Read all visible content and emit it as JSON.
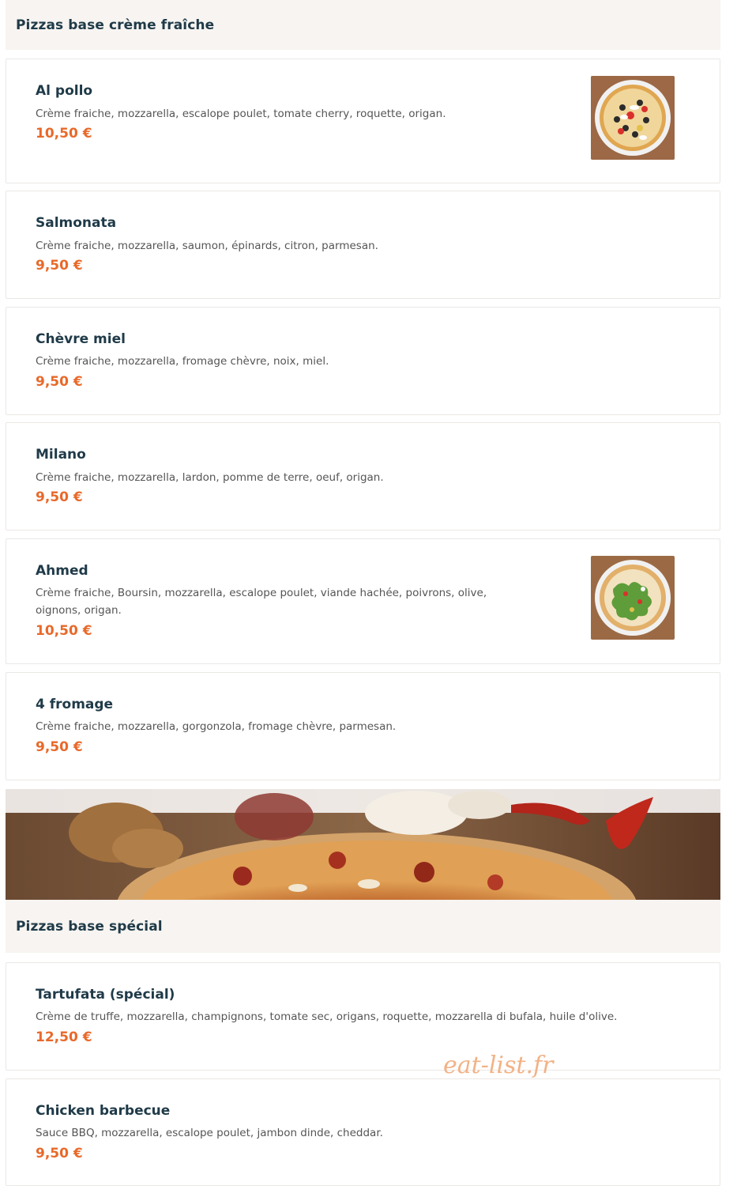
{
  "sections": [
    {
      "title": "Pizzas base crème fraîche",
      "items": [
        {
          "name": "Al pollo",
          "description": "Crème fraiche, mozzarella, escalope poulet, tomate cherry, roquette, origan.",
          "price": "10,50 €",
          "image": "pizza-photo-icon"
        },
        {
          "name": "Salmonata",
          "description": "Crème fraiche, mozzarella, saumon, épinards, citron, parmesan.",
          "price": "9,50 €"
        },
        {
          "name": "Chèvre miel",
          "description": "Crème fraiche, mozzarella, fromage chèvre, noix, miel.",
          "price": "9,50 €"
        },
        {
          "name": "Milano",
          "description": "Crème fraiche, mozzarella, lardon, pomme de terre, oeuf, origan.",
          "price": "9,50 €"
        },
        {
          "name": "Ahmed",
          "description": "Crème fraiche, Boursin, mozzarella, escalope poulet, viande hachée, poivrons, olive, oignons, origan.",
          "price": "10,50 €",
          "image": "pizza-photo-icon"
        },
        {
          "name": "4 fromage",
          "description": "Crème fraiche, mozzarella, gorgonzola, fromage chèvre, parmesan.",
          "price": "9,50 €"
        }
      ]
    },
    {
      "title": "Pizzas base spécial",
      "items": [
        {
          "name": "Tartufata (spécial)",
          "description": "Crème de truffe, mozzarella, champignons, tomate sec, origans, roquette, mozzarella di bufala, huile d'olive.",
          "price": "12,50 €"
        },
        {
          "name": "Chicken barbecue",
          "description": "Sauce BBQ, mozzarella, escalope poulet, jambon dinde, cheddar.",
          "price": "9,50 €"
        }
      ]
    }
  ],
  "watermark": "eat-list.fr",
  "colors": {
    "heading": "#1f3a48",
    "price": "#e8692a",
    "section_bg": "#f7f4f1"
  }
}
